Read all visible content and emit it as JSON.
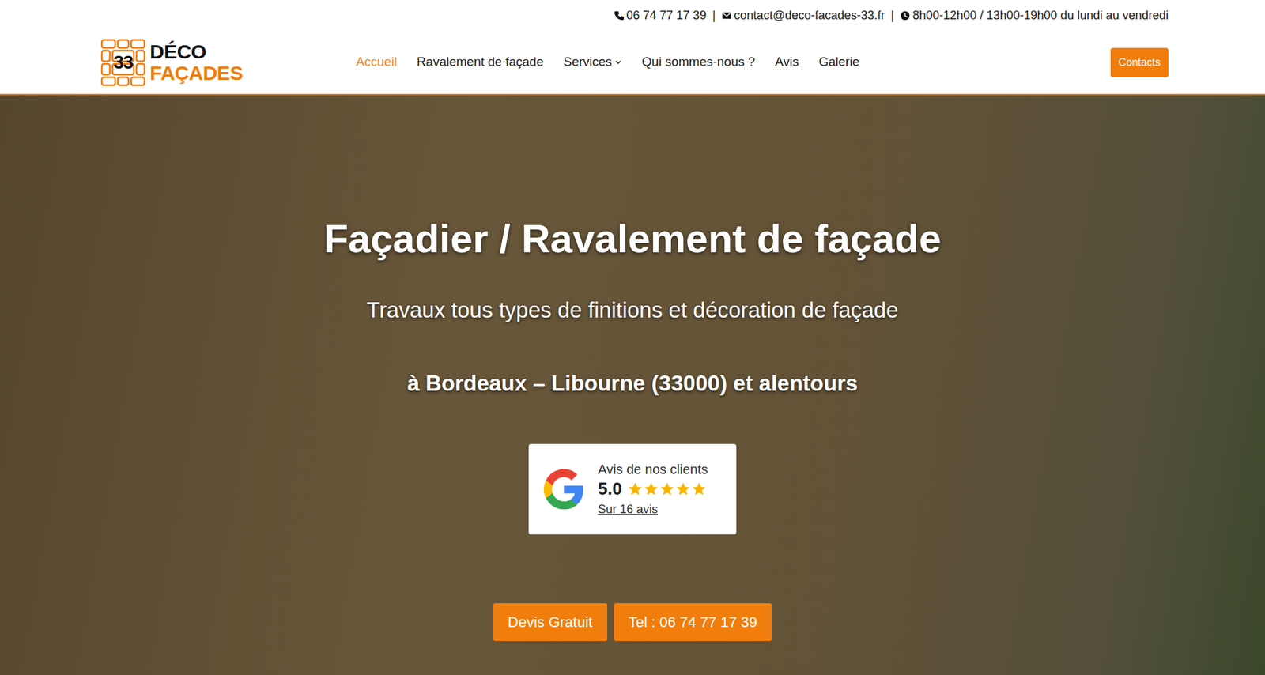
{
  "topbar": {
    "items": [
      {
        "kind": "phone",
        "text": "06 74 77 17 39"
      },
      {
        "kind": "email",
        "text": "contact@deco-facades-33.fr"
      },
      {
        "kind": "hours",
        "text": "8h00-12h00 / 13h00-19h00 du lundi au vendredi"
      }
    ],
    "separators": [
      "|",
      "|"
    ]
  },
  "logo": {
    "number": "33",
    "line1": "DÉCO",
    "line2": "FAÇADES"
  },
  "nav": [
    {
      "label": "Accueil",
      "selected": true,
      "dropdown": false
    },
    {
      "label": "Ravalement de façade",
      "selected": false,
      "dropdown": false
    },
    {
      "label": "Services",
      "selected": false,
      "dropdown": true
    },
    {
      "label": "Qui sommes-nous ?",
      "selected": false,
      "dropdown": false
    },
    {
      "label": "Avis",
      "selected": false,
      "dropdown": false
    },
    {
      "label": "Galerie",
      "selected": false,
      "dropdown": false
    }
  ],
  "contact_button": "Contacts",
  "hero": {
    "title": "Façadier / Ravalement de façade",
    "subtitle": "Travaux tous types de finitions et décoration de façade",
    "location": "à Bordeaux – Libourne (33000) et alentours"
  },
  "reviews": {
    "label": "Avis de nos clients",
    "score": "5.0",
    "stars": 5,
    "count": "Sur 16 avis"
  },
  "buttons": [
    "Devis Gratuit",
    "Tel : 06 74 77 17 39"
  ]
}
